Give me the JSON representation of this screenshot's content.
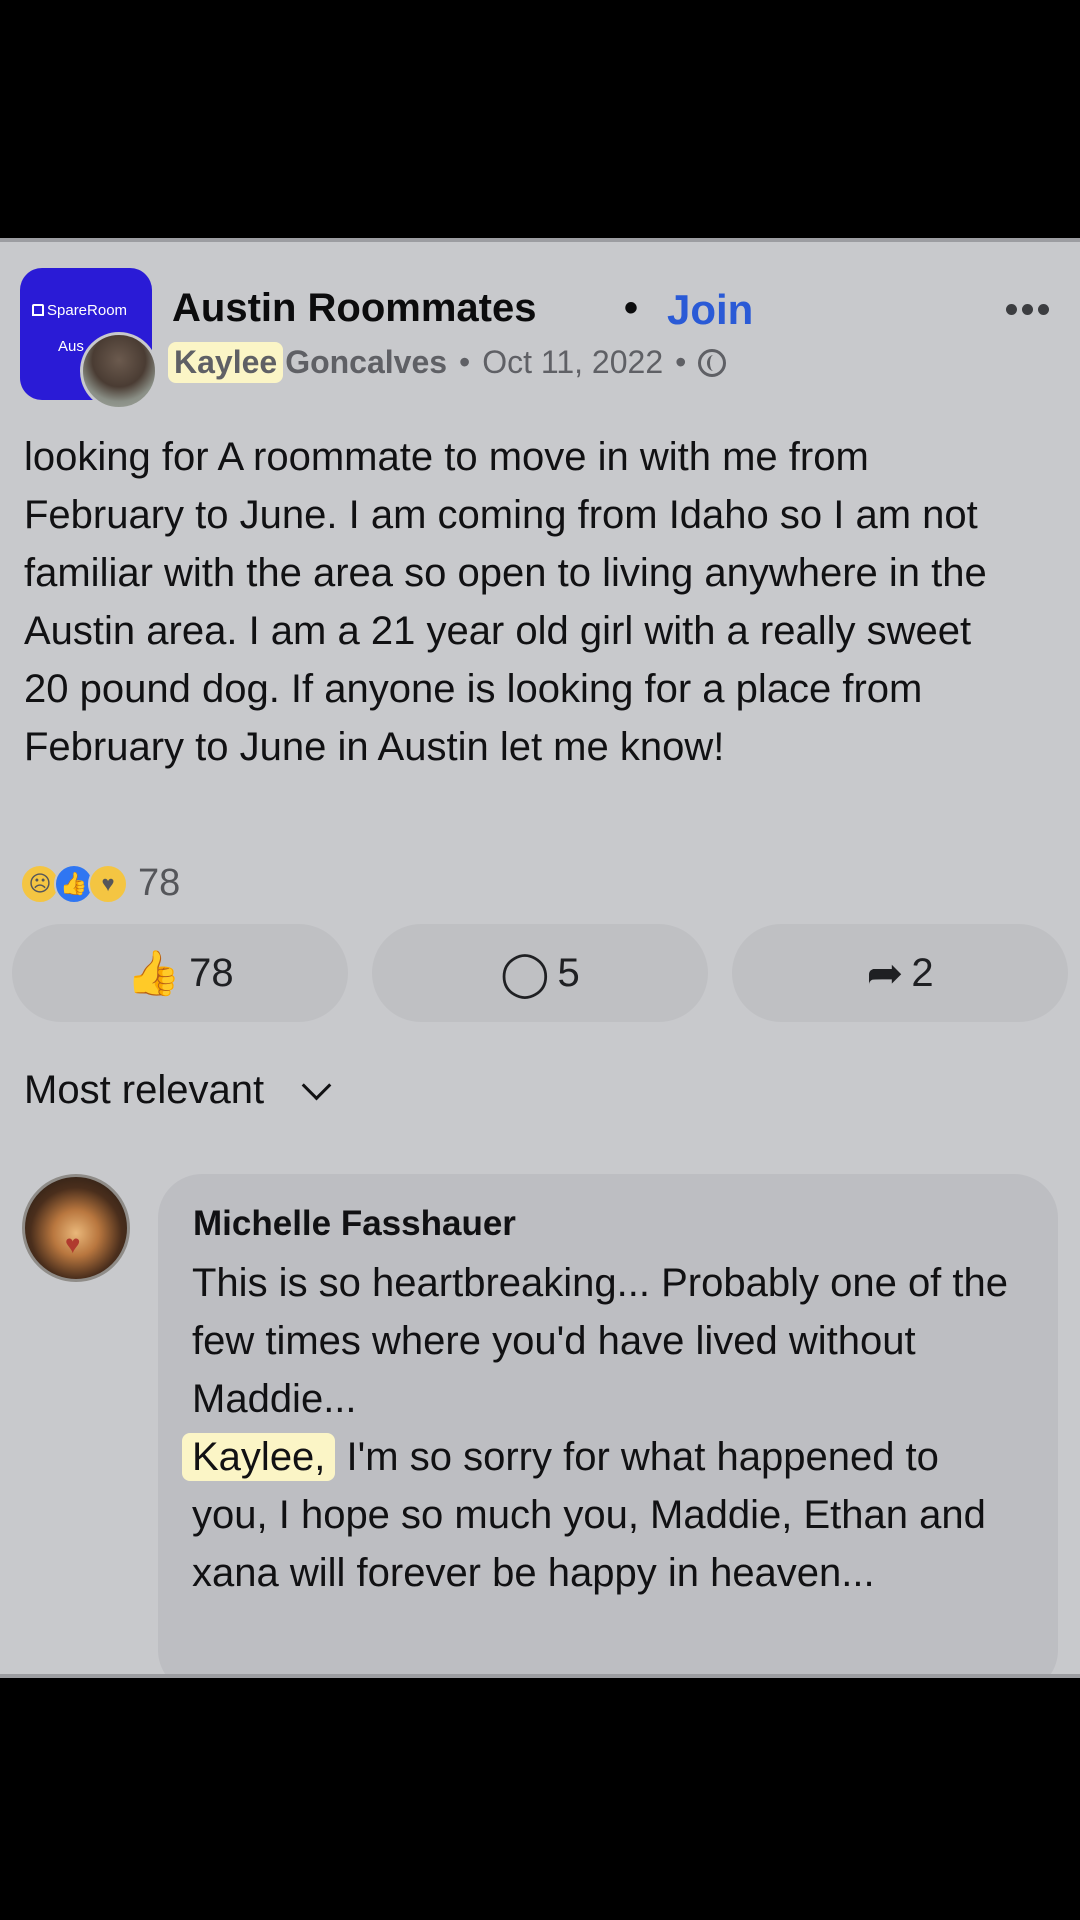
{
  "post": {
    "group_name": "Austin Roommates",
    "join_label": "Join",
    "group_avatar_text": "SpareRoom",
    "group_avatar_subtext": "Aus",
    "author_first": "Kaylee",
    "author_last": "Goncalves",
    "date": "Oct 11, 2022",
    "separator": "•",
    "body": "looking for A roommate to move in with me from February to June. I am coming from Idaho so I am not familiar with the area so open to living anywhere in the Austin area. I am a 21 year old girl with a really sweet 20 pound dog. If anyone is looking for a place from February to June in Austin let me know!",
    "reaction_count": "78",
    "reaction_icons": [
      "sad-reaction-icon",
      "like-reaction-icon",
      "care-reaction-icon"
    ]
  },
  "actions": {
    "like_count": "78",
    "comment_count": "5",
    "share_count": "2"
  },
  "sort": {
    "label": "Most relevant"
  },
  "comment": {
    "author": "Michelle Fasshauer",
    "text_part1": "This is so heartbreaking... Probably one of the few times where you'd have lived without Maddie...",
    "highlight": "Kaylee,",
    "text_part2": " I'm so sorry for what happened to you, I hope so much you, Maddie, Ethan and xana will forever be happy in heaven..."
  },
  "colors": {
    "background": "#c8c9cc",
    "join_blue": "#2a5ad6",
    "group_avatar": "#2a1bd6",
    "highlight": "#fbf5c6"
  }
}
